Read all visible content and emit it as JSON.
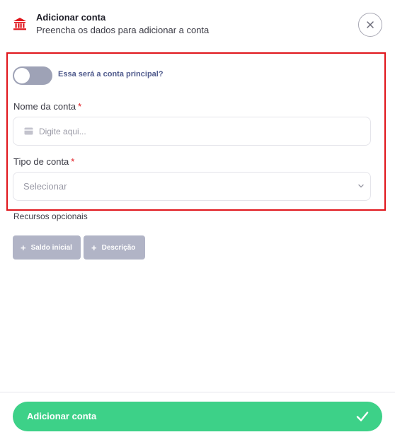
{
  "header": {
    "title": "Adicionar conta",
    "subtitle": "Preencha os dados para adicionar a conta",
    "icon": "bank-icon",
    "icon_color": "#e0151b",
    "close_icon": "close-icon"
  },
  "form": {
    "main_account_toggle": {
      "label": "Essa será a conta principal?",
      "checked": false
    },
    "name_field": {
      "label": "Nome da conta",
      "required_mark": "*",
      "placeholder": "Digite aqui...",
      "value": "",
      "icon": "card-icon"
    },
    "type_field": {
      "label": "Tipo de conta",
      "required_mark": "*",
      "selected": "Selecionar",
      "icon": "chevron-down-icon"
    }
  },
  "optional": {
    "label": "Recursos opcionais",
    "chips": [
      {
        "plus": "+",
        "label": "Saldo inicial"
      },
      {
        "plus": "+",
        "label": "Descrição"
      }
    ]
  },
  "footer": {
    "submit_label": "Adicionar conta",
    "submit_icon": "check-icon",
    "submit_color": "#3dd188"
  },
  "colors": {
    "highlight_border": "#e0151b",
    "toggle_off": "#9ea2b6",
    "chip_disabled": "#b1b4c6"
  }
}
